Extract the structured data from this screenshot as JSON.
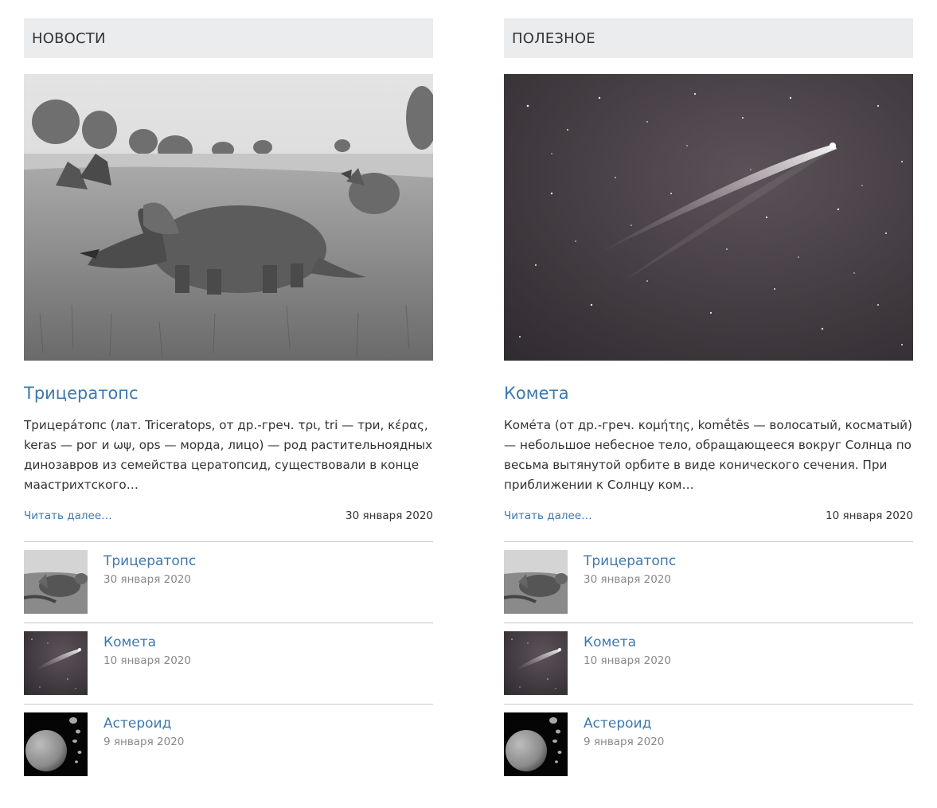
{
  "columns": [
    {
      "header": "НОВОСТИ",
      "featured": {
        "image": "triceratops-illustration",
        "title": "Трицератопс",
        "excerpt": "Трицера́топс (лат. Triceratops, от др.-греч. τρι, tri — три, κέρας, keras — рог и ωψ, ops — морда, лицо) — род растительноядных динозавров из семейства цератопсид, существовали в конце маастрихтского…",
        "read_more": "Читать далее…",
        "date": "30 января 2020"
      },
      "related": [
        {
          "image": "triceratops-thumbnail",
          "title": "Трицератопс",
          "date": "30 января 2020"
        },
        {
          "image": "comet-thumbnail",
          "title": "Комета",
          "date": "10 января 2020"
        },
        {
          "image": "asteroid-thumbnail",
          "title": "Астероид",
          "date": "9 января 2020"
        }
      ]
    },
    {
      "header": "ПОЛЕЗНОЕ",
      "featured": {
        "image": "comet-photo",
        "title": "Комета",
        "excerpt": "Коме́та (от др.-греч. κομήτης, komḗtēs — волосатый, косматый) — небольшое небесное тело, обращающееся вокруг Солнца по весьма вытянутой орбите в виде конического сечения. При приближении к Солнцу ком…",
        "read_more": "Читать далее…",
        "date": "10 января 2020"
      },
      "related": [
        {
          "image": "triceratops-thumbnail",
          "title": "Трицератопс",
          "date": "30 января 2020"
        },
        {
          "image": "comet-thumbnail",
          "title": "Комета",
          "date": "10 января 2020"
        },
        {
          "image": "asteroid-thumbnail",
          "title": "Астероид",
          "date": "9 января 2020"
        }
      ]
    }
  ],
  "colors": {
    "link": "#3d78ad",
    "header_bg": "#ebecee",
    "text": "#333333",
    "muted_date": "#888888",
    "divider": "#c8c8c8"
  }
}
